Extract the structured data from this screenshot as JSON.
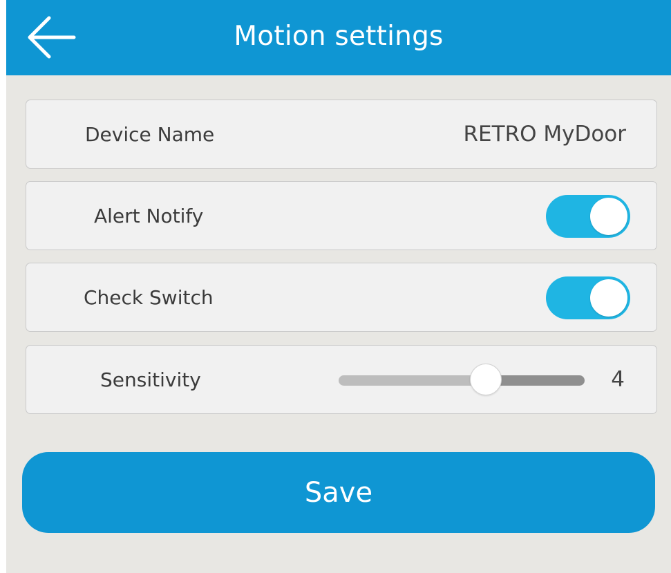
{
  "colors": {
    "primary": "#0f96d3",
    "toggle_on": "#1fb5e3",
    "background": "#e8e7e3",
    "row_background": "#f1f1f1"
  },
  "header": {
    "back_icon": "arrow-left-icon",
    "title": "Motion settings"
  },
  "settings": {
    "device_name": {
      "label": "Device Name",
      "value": "RETRO MyDoor"
    },
    "alert_notify": {
      "label": "Alert Notify",
      "enabled": true
    },
    "check_switch": {
      "label": "Check Switch",
      "enabled": true
    },
    "sensitivity": {
      "label": "Sensitivity",
      "value": "4",
      "level_fraction": 0.6
    }
  },
  "actions": {
    "save_label": "Save"
  }
}
